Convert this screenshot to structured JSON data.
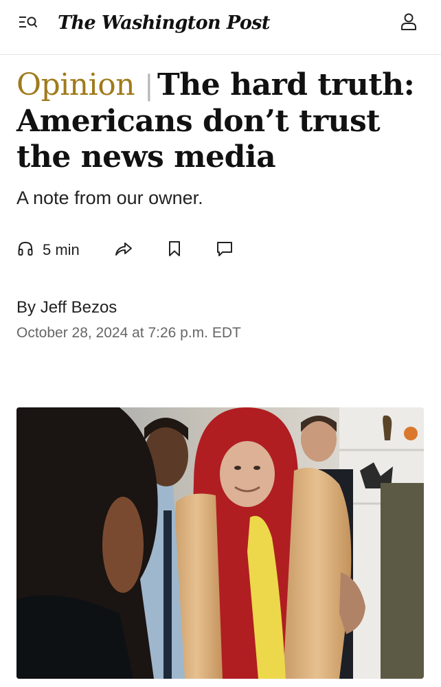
{
  "header": {
    "masthead": "The Washington Post",
    "menu_icon": "menu-search-icon",
    "account_icon": "user-icon"
  },
  "article": {
    "kicker": "Opinion",
    "title": "The hard truth: Americans don’t trust the news media",
    "subtitle": "A note from our owner.",
    "listen_time": "5 min",
    "byline_prefix": "By ",
    "author": "Jeff Bezos",
    "date": "October 28, 2024 at 7:26 p.m. EDT"
  },
  "actions": {
    "listen_icon": "headphones-icon",
    "share_icon": "share-arrow-icon",
    "save_icon": "bookmark-icon",
    "comment_icon": "comment-icon"
  },
  "colors": {
    "kicker": "#a07a1c",
    "text": "#111111",
    "meta": "#666666",
    "divider": "#e6e6e6"
  }
}
